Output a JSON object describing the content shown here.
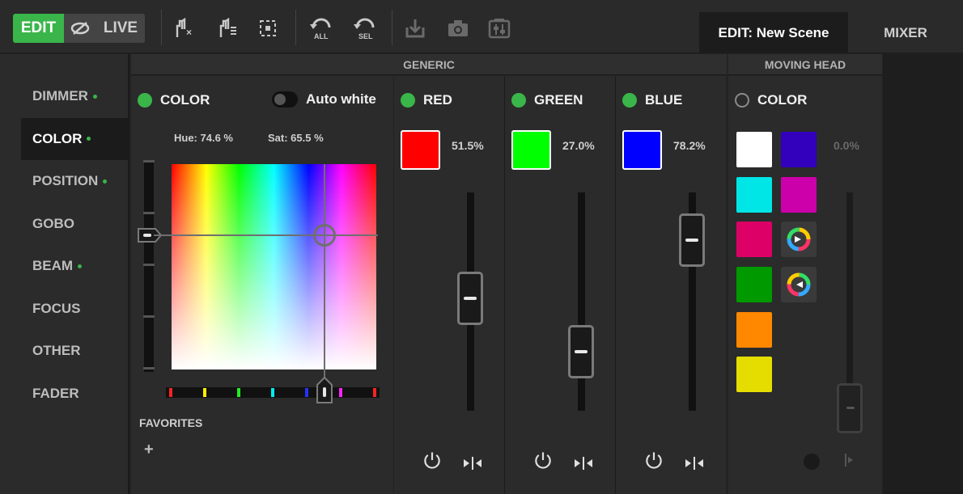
{
  "toolbar": {
    "edit_label": "EDIT",
    "live_label": "LIVE",
    "all_label": "ALL",
    "sel_label": "SEL",
    "edit_tab": "EDIT: New Scene",
    "mixer_tab": "MIXER",
    "accent_color": "#3ab54a"
  },
  "sidebar": {
    "items": [
      {
        "label": "DIMMER",
        "dot": true
      },
      {
        "label": "COLOR",
        "dot": true,
        "active": true
      },
      {
        "label": "POSITION",
        "dot": true
      },
      {
        "label": "GOBO",
        "dot": false
      },
      {
        "label": "BEAM",
        "dot": true
      },
      {
        "label": "FOCUS",
        "dot": false
      },
      {
        "label": "OTHER",
        "dot": false
      },
      {
        "label": "FADER",
        "dot": false
      }
    ]
  },
  "sections": {
    "generic": "GENERIC",
    "moving_head": "MOVING HEAD"
  },
  "color_panel": {
    "title": "COLOR",
    "auto_white_label": "Auto white",
    "auto_white_on": false,
    "hue_text": "Hue: 74.6 %",
    "sat_text": "Sat: 65.5 %",
    "hue": 0.746,
    "sat": 0.655,
    "favorites_label": "FAVORITES",
    "add_label": "+"
  },
  "channels": [
    {
      "name": "RED",
      "value_text": "51.5%",
      "value": 0.515,
      "color": "#ff0000"
    },
    {
      "name": "GREEN",
      "value_text": "27.0%",
      "value": 0.27,
      "color": "#00ff00"
    },
    {
      "name": "BLUE",
      "value_text": "78.2%",
      "value": 0.782,
      "color": "#0000ff"
    }
  ],
  "moving_head": {
    "title": "COLOR",
    "value_text": "0.0%",
    "swatches": [
      "#ffffff",
      "#3300bb",
      "#00e5e5",
      "#cc00aa",
      "#dd0066",
      "#009900",
      "#ff8800",
      "#e5dd00"
    ]
  }
}
